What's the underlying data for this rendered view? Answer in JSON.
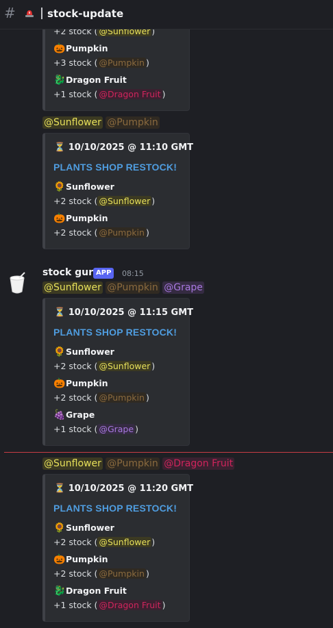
{
  "channel": {
    "icon": "hash-icon",
    "emoji_icon": "siren-icon",
    "name": "stock-update"
  },
  "author": {
    "name": "stock gurt",
    "badge": "APP",
    "time": "08:15"
  },
  "labels": {
    "restock": "PLANTS SHOP RESTOCK!",
    "stock_prefix": "+",
    "stock_suffix": " stock (",
    "close": ")"
  },
  "items": {
    "sunflower": "Sunflower",
    "pumpkin": "Pumpkin",
    "dragon": "Dragon Fruit",
    "grape": "Grape"
  },
  "mentions": {
    "sunflower": "@Sunflower",
    "pumpkin": "@Pumpkin",
    "dragon": "@Dragon Fruit",
    "grape": "@Grape"
  },
  "msg0": {
    "row1": "+2 stock (",
    "row2": "+3 stock (",
    "row3": "+1 stock ("
  },
  "msg1": {
    "title": "10/10/2025 @ 11:10 GMT",
    "row1": "+2 stock (",
    "row2": "+2 stock ("
  },
  "msg2": {
    "title": "10/10/2025 @ 11:15 GMT",
    "row1": "+2 stock (",
    "row2": "+2 stock (",
    "row3": "+1 stock ("
  },
  "msg3": {
    "title": "10/10/2025 @ 11:20 GMT",
    "row1": "+2 stock (",
    "row2": "+2 stock (",
    "row3": "+1 stock ("
  },
  "colors": {
    "sunflower_role": "#e7e05a",
    "pumpkin_role": "#8a6a3e",
    "dragon_role": "#d0245c",
    "grape_role": "#a878e0",
    "restock_title": "#4f9de0",
    "new_divider": "#c93d45"
  }
}
